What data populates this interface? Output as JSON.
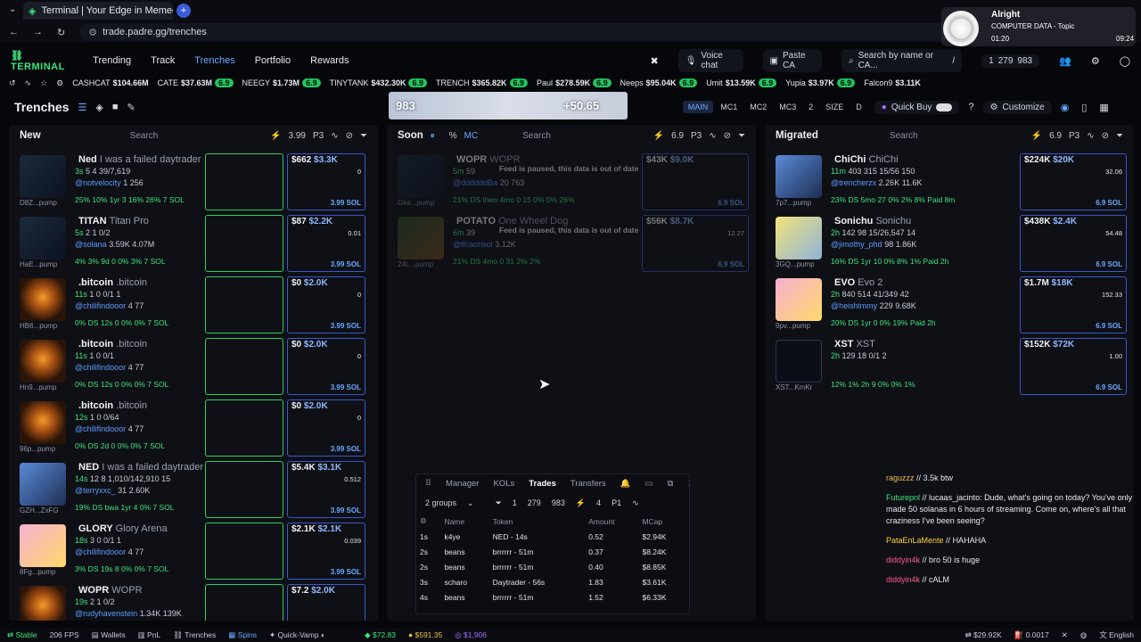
{
  "browser": {
    "tab_title": "Terminal | Your Edge in Memec",
    "url": "trade.padre.gg/trenches"
  },
  "music": {
    "title": "Alright",
    "subtitle": "COMPUTER DATA - Topic",
    "time_left": "01:20",
    "time_right": "09:24"
  },
  "nav": {
    "brand": "TERMINAL",
    "items": [
      "Trending",
      "Track",
      "Trenches",
      "Portfolio",
      "Rewards"
    ],
    "voice_chat": "Voice chat",
    "paste_ca": "Paste CA",
    "search_placeholder": "Search by name or CA...",
    "search_shortcut": "/",
    "counts": [
      "1",
      "279",
      "983"
    ]
  },
  "ticker": [
    {
      "name": "CASHCAT",
      "price": "$104.66M"
    },
    {
      "name": "CATE",
      "price": "$37.63M",
      "badge": "6.9"
    },
    {
      "name": "NEEGY",
      "price": "$1.73M",
      "badge": "6.9"
    },
    {
      "name": "TINYTANK",
      "price": "$432.30K",
      "badge": "6.9"
    },
    {
      "name": "TRENCH",
      "price": "$365.82K",
      "badge": "6.9"
    },
    {
      "name": "Paul",
      "price": "$278.59K",
      "badge": "6.9"
    },
    {
      "name": "Neeps",
      "price": "$95.04K",
      "badge": "6.9"
    },
    {
      "name": "Umit",
      "price": "$13.59K",
      "badge": "6.9"
    },
    {
      "name": "Yupia",
      "price": "$3.97K",
      "badge": "6.9"
    },
    {
      "name": "Falcon9",
      "price": "$3.11K"
    }
  ],
  "trenches": {
    "title": "Trenches",
    "banner_count": "983",
    "banner_gain": "+50.65",
    "modes": [
      "MAIN",
      "MC1",
      "MC2",
      "MC3",
      "2",
      "SIZE",
      "D"
    ],
    "quick_buy": "Quick Buy",
    "customize": "Customize"
  },
  "columns": {
    "new": {
      "title": "New",
      "search": "Search",
      "amount": "3.99",
      "preset": "P3"
    },
    "soon": {
      "title": "Soon",
      "pct": "%",
      "mc": "MC",
      "search": "Search",
      "amount": "6.9",
      "preset": "P3"
    },
    "migrated": {
      "title": "Migrated",
      "search": "Search",
      "amount": "6.9",
      "preset": "P3"
    }
  },
  "new_cards": [
    {
      "id": "D8Z...pump",
      "name": "Ned",
      "sub": "I was a failed daytrader",
      "age": "3s",
      "stats": "5 4 39/7,619",
      "user": "@notvelocity",
      "w": "1 256",
      "f": "25% 10% 1yr 3 16% 26% 7 SOL",
      "v": "$662",
      "mc": "$3.3K",
      "fv": "0",
      "sol": "3.99 SOL",
      "thumb": "dark"
    },
    {
      "id": "HaE...pump",
      "name": "TITAN",
      "sub": "Titan Pro",
      "age": "5s",
      "stats": "2 1 0/2",
      "user": "@solana",
      "w": "3.59K 4.07M",
      "f": "4% 3% 9d 0 0% 3% 7 SOL",
      "v": "$87",
      "mc": "$2.2K",
      "fv": "0.01",
      "sol": "3.99 SOL",
      "thumb": "dark"
    },
    {
      "id": "HB6...pump",
      "name": ".bitcoin",
      "sub": ".bitcoin",
      "age": "11s",
      "stats": "1 0 0/1 1",
      "user": "@chilifindooor",
      "w": "4 77",
      "f": "0% DS 12s 0 0% 0% 7 SOL",
      "v": "$0",
      "mc": "$2.0K",
      "fv": "0",
      "sol": "3.99 SOL",
      "thumb": "orange"
    },
    {
      "id": "Hn9...pump",
      "name": ".bitcoin",
      "sub": ".bitcoin",
      "age": "11s",
      "stats": "1 0 0/1",
      "user": "@chilifindooor",
      "w": "4 77",
      "f": "0% DS 12s 0 0% 0% 7 SOL",
      "v": "$0",
      "mc": "$2.0K",
      "fv": "0",
      "sol": "3.99 SOL",
      "thumb": "orange"
    },
    {
      "id": "96p...pump",
      "name": ".bitcoin",
      "sub": ".bitcoin",
      "age": "12s",
      "stats": "1 0 0/64",
      "user": "@chilifindooor",
      "w": "4 77",
      "f": "0% DS 2d 0 0% 0% 7 SOL",
      "v": "$0",
      "mc": "$2.0K",
      "fv": "0",
      "sol": "3.99 SOL",
      "thumb": "orange"
    },
    {
      "id": "GZH...ZxFG",
      "name": "NED",
      "sub": "I was a failed daytrader",
      "age": "14s",
      "stats": "12 8 1,010/142,910 15",
      "user": "@terryxxc_",
      "w": "31 2.60K",
      "f": "19% DS bwa 1yr 4 0% 7 SOL",
      "v": "$5.4K",
      "mc": "$3.1K",
      "fv": "0.512",
      "sol": "3.99 SOL",
      "thumb": "blue"
    },
    {
      "id": "8Fg...pump",
      "name": "GLORY",
      "sub": "Glory Arena",
      "age": "18s",
      "stats": "3 0 0/1 1",
      "user": "@chilifindooor",
      "w": "4 77",
      "f": "3% DS 19s 8 0% 0% 7 SOL",
      "v": "$2.1K",
      "mc": "$2.1K",
      "fv": "0.039",
      "sol": "3.99 SOL",
      "thumb": "pink"
    },
    {
      "id": "",
      "name": "WOPR",
      "sub": "WOPR",
      "age": "19s",
      "stats": "2 1 0/2",
      "user": "@rudyhavenstein",
      "w": "1.34K 139K",
      "f": "",
      "v": "$7.2",
      "mc": "$2.0K",
      "fv": "",
      "sol": "",
      "thumb": "orange"
    }
  ],
  "soon_cards": [
    {
      "id": "Gka...pump",
      "name": "WOPR",
      "sub": "WOPR",
      "age": "5m",
      "stats": "59",
      "user": "@ddddddBa",
      "w": "20 763",
      "f": "21% DS theo 4mo 0 15 0% 0% 26%",
      "v": "$43K",
      "mc": "$9.0K",
      "fv": "",
      "sol": "6.9 SOL",
      "paused": "Feed is paused, this data is out of date",
      "thumb": "dark"
    },
    {
      "id": "24L...pump",
      "name": "POTATO",
      "sub": "One Wheel Dog",
      "age": "6m",
      "stats": "39",
      "user": "@tlcaonsol",
      "w": "3.12K",
      "f": "21% DS 4mo 0 31 2% 2%",
      "v": "$56K",
      "mc": "$8.7K",
      "fv": "12.27",
      "sol": "6.9 SOL",
      "paused": "Feed is paused, this data is out of date",
      "thumb": "green"
    }
  ],
  "migrated_cards": [
    {
      "id": "7p7...pump",
      "name": "ChiChi",
      "sub": "ChiChi",
      "age": "11m",
      "stats": "403 315 15/56 150",
      "user": "@trencherzx",
      "w": "2.26K 11.6K",
      "f": "23% DS 5mo 27 0% 2% 8% Paid 8m",
      "v": "$224K",
      "mc": "$20K",
      "fv": "32.06",
      "sol": "6.9 SOL",
      "thumb": "blue"
    },
    {
      "id": "3GQ...pump",
      "name": "Sonichu",
      "sub": "Sonichu",
      "age": "2h",
      "stats": "142 98 15/26,547 14",
      "user": "@jimothy_phd",
      "w": "98 1.86K",
      "f": "16% DS 1yr 10 0% 8% 1% Paid 2h",
      "v": "$438K",
      "mc": "$2.4K",
      "fv": "54.48",
      "sol": "6.9 SOL",
      "thumb": "yellow"
    },
    {
      "id": "9pv...pump",
      "name": "EVO",
      "sub": "Evo 2",
      "age": "2h",
      "stats": "840 514 41/349 42",
      "user": "@heishimmy",
      "w": "229 9.68K",
      "f": "20% DS 1yr 0 0% 19% Paid 2h",
      "v": "$1.7M",
      "mc": "$18K",
      "fv": "152.33",
      "sol": "6.9 SOL",
      "thumb": "pink"
    },
    {
      "id": "XST...KmKr",
      "name": "XST",
      "sub": "XST",
      "age": "2h",
      "stats": "129 18 0/1 2",
      "user": "",
      "w": "",
      "f": "12% 1% 2h 9 0% 0% 1%",
      "v": "$152K",
      "mc": "$72K",
      "fv": "1.00",
      "sol": "6.9 SOL",
      "thumb": "x"
    }
  ],
  "trades": {
    "tabs": [
      "Manager",
      "KOLs",
      "Trades",
      "Transfers"
    ],
    "groups": "2 groups",
    "counts": [
      "1",
      "279",
      "983"
    ],
    "preset": "4",
    "p": "P1",
    "headers": [
      "Name",
      "Token",
      "Amount",
      "MCap"
    ],
    "rows": [
      {
        "age": "1s",
        "name": "k4ye",
        "token": "NED - 14s",
        "amount": "0.52",
        "mcap": "$2.94K",
        "side": "buy"
      },
      {
        "age": "2s",
        "name": "beans",
        "token": "brrrrrr - 51m",
        "amount": "0.37",
        "mcap": "$8.24K",
        "side": "buy"
      },
      {
        "age": "2s",
        "name": "beans",
        "token": "brrrrrr - 51m",
        "amount": "0.40",
        "mcap": "$8.85K",
        "side": "buy"
      },
      {
        "age": "3s",
        "name": "scharo",
        "token": "Daytrader - 56s",
        "amount": "1.83",
        "mcap": "$3.61K",
        "side": "sell"
      },
      {
        "age": "4s",
        "name": "beans",
        "token": "brrrrrr - 51m",
        "amount": "1.52",
        "mcap": "$6.33K",
        "side": "sell"
      }
    ]
  },
  "chat": [
    {
      "user": "raguzzz",
      "text": "3.5k btw",
      "cls": "u1"
    },
    {
      "user": "Futurepnl",
      "text": "lucaas_jacinto: Dude, what's going on today? You've only made 50 solanas in 6 hours of streaming. Come on, where's all that craziness I've been seeing?",
      "cls": "u2"
    },
    {
      "user": "PataEnLaMente",
      "text": "HAHAHA",
      "cls": "u3"
    },
    {
      "user": "diddyin4k",
      "text": "bro 50 is huge",
      "cls": "u4"
    },
    {
      "user": "diddyin4k",
      "text": "cALM",
      "cls": "u4"
    }
  ],
  "status": {
    "stable": "Stable",
    "fps": "206 FPS",
    "wallets": "Wallets",
    "pnl": "PnL",
    "trenches": "Trenches",
    "spins": "Spins",
    "quick_vamp": "Quick-Vamp",
    "btc": "$72.83",
    "eth": "$591.35",
    "sol": "$1,906",
    "vol": "$29.92K",
    "fee": "0.0017",
    "lang": "English"
  },
  "colors": {
    "green": "#3ee47a",
    "blue": "#5b9cff",
    "red": "#ff5a66",
    "accent": "#6aa9ff"
  }
}
